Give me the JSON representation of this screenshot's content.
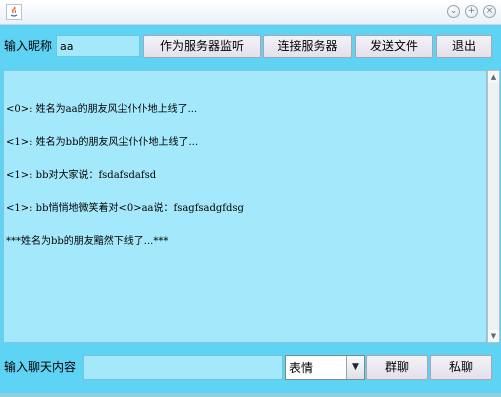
{
  "window": {
    "controls": [
      "⌄",
      "+",
      "×"
    ]
  },
  "toolbar": {
    "nickname_label": "输入昵称",
    "nickname_value": "aa",
    "listen_button": "作为服务器监听",
    "connect_button": "连接服务器",
    "send_file_button": "发送文件",
    "exit_button": "退出"
  },
  "chat": {
    "messages": [
      "<0>: 姓名为aa的朋友风尘仆仆地上线了...",
      "<1>: 姓名为bb的朋友风尘仆仆地上线了...",
      "<1>: bb对大家说：fsdafsdafsd",
      "<1>: bb悄悄地微笑着对<0>aa说：fsagfsadgfdsg",
      "***姓名为bb的朋友黯然下线了...***"
    ]
  },
  "compose": {
    "label": "输入聊天内容",
    "input_value": "",
    "emoji_select": "表情",
    "group_chat_button": "群聊",
    "private_chat_button": "私聊"
  },
  "colors": {
    "window_bg": "#5fd3f3",
    "field_bg": "#a4e9fb"
  }
}
